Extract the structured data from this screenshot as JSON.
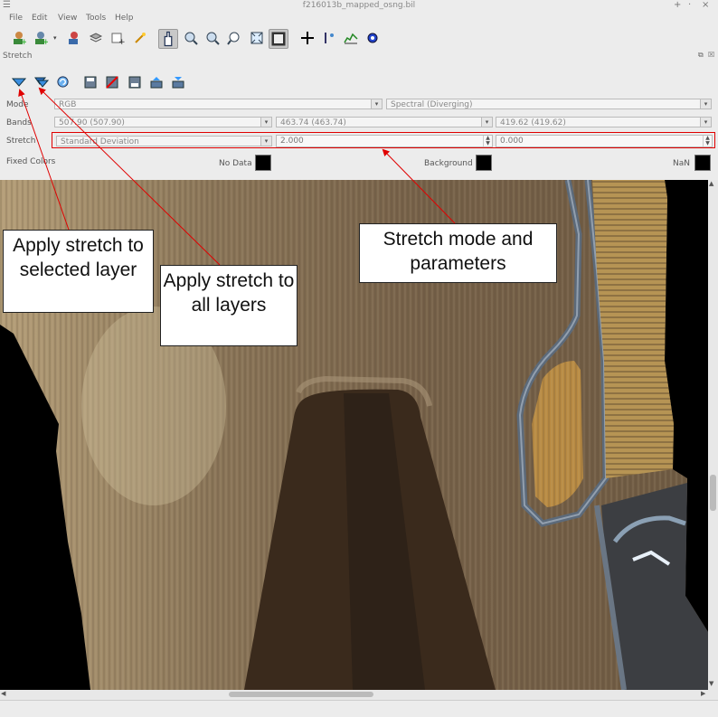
{
  "window": {
    "title": "f216013b_mapped_osng.bil",
    "controls": [
      "+",
      "·",
      "×"
    ]
  },
  "menu": [
    "File",
    "Edit",
    "View",
    "Tools",
    "Help"
  ],
  "toolbar_icons": [
    "add-layer-icon",
    "add-remote-layer-icon",
    "remove-layer-icon",
    "layers-stack-icon",
    "new-window-icon",
    "wand-icon",
    "pan-icon",
    "zoom-in-icon",
    "zoom-out-icon",
    "zoom-fit-icon",
    "zoom-full-icon",
    "zoom-selection-icon",
    "crosshair-icon",
    "pixel-info-icon",
    "spectral-plot-icon",
    "settings-gear-icon"
  ],
  "stretch_panel": {
    "title": "Stretch",
    "toolbar_icons": [
      "apply-selected-icon",
      "apply-all-icon",
      "reset-icon",
      "save-icon",
      "clear-icon",
      "save-as-icon",
      "import-icon",
      "export-icon"
    ],
    "mode_label": "Mode",
    "mode_value": "RGB",
    "colormap_value": "Spectral (Diverging)",
    "bands_label": "Bands",
    "band_r": "507.90 (507.90)",
    "band_g": "463.74 (463.74)",
    "band_b": "419.62 (419.62)",
    "stretch_label": "Stretch",
    "stretch_value": "Standard Deviation",
    "param_1": "2.000",
    "param_2": "0.000",
    "fixed_colors_label": "Fixed Colors",
    "no_data_label": "No Data",
    "background_label": "Background",
    "nan_label": "NaN",
    "no_data_color": "#000000",
    "background_color": "#000000",
    "nan_color": "#000000"
  },
  "callouts": {
    "selected": "Apply stretch to selected layer",
    "all": "Apply stretch to all layers",
    "mode": "Stretch mode and parameters"
  },
  "colors": {
    "annotation_red": "#e00000",
    "field_tan": "#8a7558"
  }
}
